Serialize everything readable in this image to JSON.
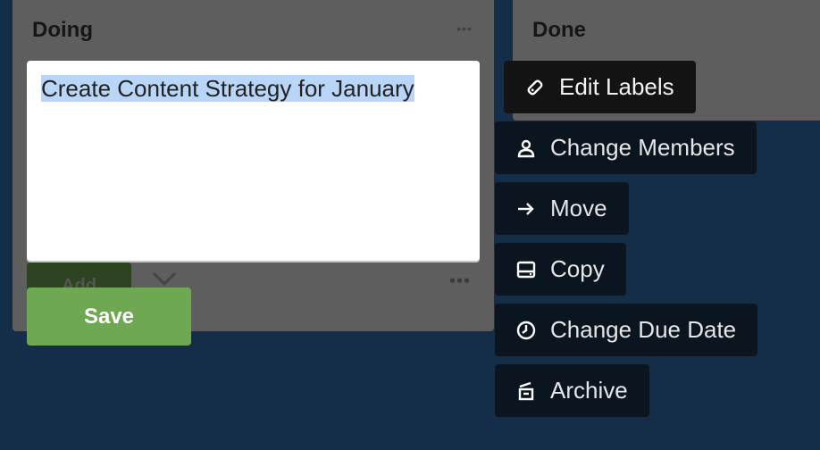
{
  "lists": {
    "doing": {
      "title": "Doing",
      "menu": "•••",
      "footer_menu": "•••",
      "add_label": "Add"
    },
    "done": {
      "title": "Done"
    }
  },
  "editor": {
    "card_text": "Create Content Strategy for January",
    "save_label": "Save"
  },
  "quick_actions": [
    {
      "label": "Edit Labels",
      "icon": "tag-icon"
    },
    {
      "label": "Change Members",
      "icon": "person-icon"
    },
    {
      "label": "Move",
      "icon": "arrow-right-icon"
    },
    {
      "label": "Copy",
      "icon": "card-icon"
    },
    {
      "label": "Change Due Date",
      "icon": "clock-icon"
    },
    {
      "label": "Archive",
      "icon": "archive-icon"
    }
  ],
  "colors": {
    "board_bg": "#142e4a",
    "save_green": "#6ea852",
    "action_bg": "#0b1520"
  }
}
